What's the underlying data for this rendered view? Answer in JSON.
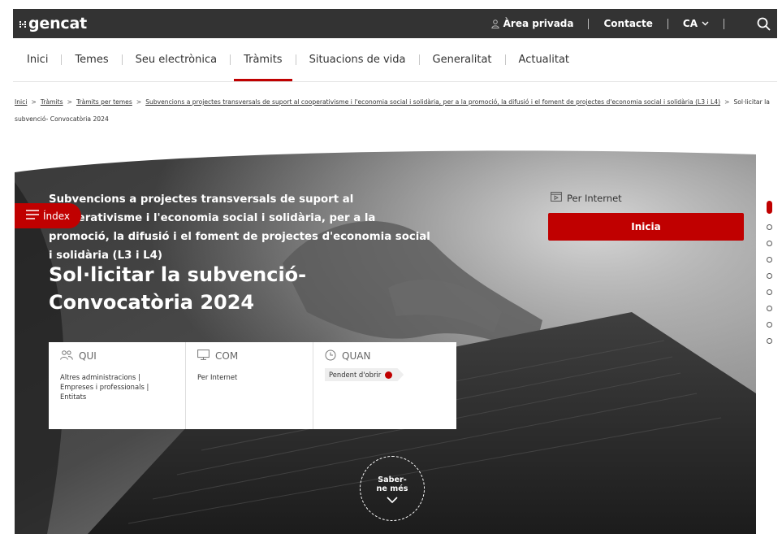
{
  "header": {
    "logo_text": "gencat",
    "area_privada": "Àrea privada",
    "contacte": "Contacte",
    "language": "CA",
    "icons": [
      "user-icon",
      "chevron-down-icon",
      "search-icon"
    ]
  },
  "nav": {
    "items": [
      {
        "label": "Inici"
      },
      {
        "label": "Temes"
      },
      {
        "label": "Seu electrònica"
      },
      {
        "label": "Tràmits",
        "active": true
      },
      {
        "label": "Situacions de vida"
      },
      {
        "label": "Generalitat"
      },
      {
        "label": "Actualitat"
      }
    ]
  },
  "breadcrumb": {
    "items": [
      "Inici",
      "Tràmits",
      "Tràmits per temes",
      "Subvencions a projectes transversals de suport al cooperativisme i l'economia social i solidària, per a la promoció, la difusió i el foment de projectes d'economia social i solidària (L3 i L4)"
    ],
    "current": "Sol·licitar la subvenció- Convocatòria 2024",
    "separator": ">"
  },
  "hero": {
    "subtitle": "Subvencions a projectes transversals de suport al cooperativisme i l'economia social i solidària, per a la promoció, la difusió i el foment de projectes d'economia social i solidària (L3 i L4)",
    "title": "Sol·licitar la subvenció- Convocatòria 2024",
    "index_label": "Índex",
    "saber_mes": "Saber-ne més"
  },
  "info": {
    "qui": {
      "label": "QUI",
      "value": "Altres administracions | Empreses i professionals | Entitats"
    },
    "com": {
      "label": "COM",
      "value": "Per Internet"
    },
    "quan": {
      "label": "QUAN",
      "value": "Pendent d'obrir"
    }
  },
  "action": {
    "channel": "Per Internet",
    "button": "Inicia"
  },
  "pager": {
    "count": 9,
    "active_index": 0
  },
  "colors": {
    "brand_red": "#c00000",
    "topbar": "#333333"
  }
}
